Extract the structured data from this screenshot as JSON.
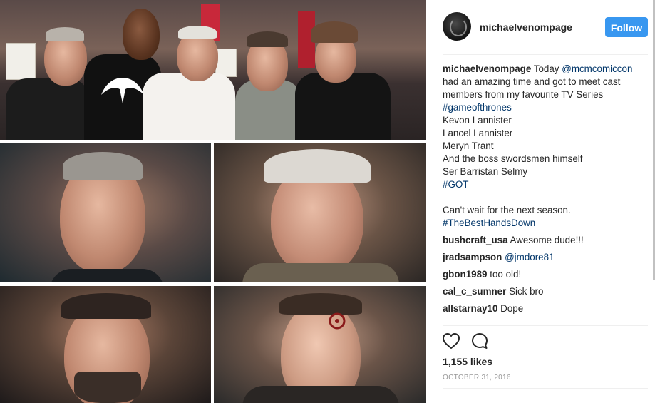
{
  "post": {
    "username": "michaelvenompage",
    "follow_label": "Follow",
    "caption": {
      "username": "michaelvenompage",
      "part1": " Today ",
      "mention": "@mcmcomiccon",
      "part2": " had an amazing time and got to meet cast members from my favourite TV Series ",
      "hashtag1": "#gameofthrones",
      "part3": "\nKevon Lannister\nLancel Lannister\nMeryn Trant\nAnd the boss swordsmen himself\nSer Barristan Selmy\n",
      "hashtag2": "#GOT",
      "part4": "\n\nCan't wait for the next season.\n",
      "hashtag3": "#TheBestHandsDown"
    },
    "comments": [
      {
        "username": "bushcraft_usa",
        "text": "Awesome dude!!!"
      },
      {
        "username": "jradsampson",
        "mention": "@jmdore81",
        "text": ""
      },
      {
        "username": "gbon1989",
        "text": "too old!"
      },
      {
        "username": "cal_c_sumner",
        "text": "Sick bro"
      },
      {
        "username": "allstarnay10",
        "text": "Dope"
      }
    ],
    "likes": "1,155 likes",
    "date": "OCTOBER 31, 2016"
  },
  "icons": {
    "like": "heart-outline-icon",
    "comment": "comment-bubble-icon"
  },
  "colors": {
    "accent": "#3897f0",
    "link": "#003569",
    "muted": "#999999"
  }
}
